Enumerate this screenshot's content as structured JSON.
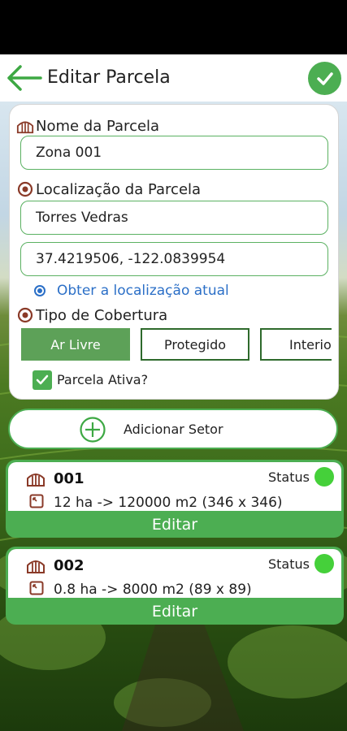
{
  "app": {
    "title": "Editar Parcela"
  },
  "form": {
    "name_label": "Nome da Parcela",
    "name_value": "Zona 001",
    "location_label": "Localização da Parcela",
    "location_value": "Torres Vedras",
    "coords_value": "37.4219506, -122.0839954",
    "get_location_label": "Obter a localização atual",
    "cover_label": "Tipo de Cobertura",
    "cover_options": [
      {
        "label": "Ar Livre",
        "selected": true
      },
      {
        "label": "Protegido",
        "selected": false
      },
      {
        "label": "Interior",
        "selected": false
      }
    ],
    "active_label": "Parcela Ativa?",
    "active_checked": true
  },
  "add_sector_label": "Adicionar Setor",
  "sectors": [
    {
      "id": "001",
      "status_label": "Status",
      "status_color": "#45d03a",
      "area": "12 ha -> 120000 m2 (346 x 346)",
      "edit_label": "Editar"
    },
    {
      "id": "002",
      "status_label": "Status",
      "status_color": "#45d03a",
      "area": "0.8 ha -> 8000 m2 (89 x 89)",
      "edit_label": "Editar"
    }
  ],
  "colors": {
    "accent": "#4cae52",
    "segment_active": "#5da158",
    "segment_border": "#2e6a2c",
    "link": "#2b6fc7"
  },
  "icons": [
    "back-arrow-icon",
    "check-icon",
    "greenhouse-icon",
    "location-pin-icon",
    "gps-dot-icon",
    "plus-circle-icon",
    "area-square-icon"
  ]
}
